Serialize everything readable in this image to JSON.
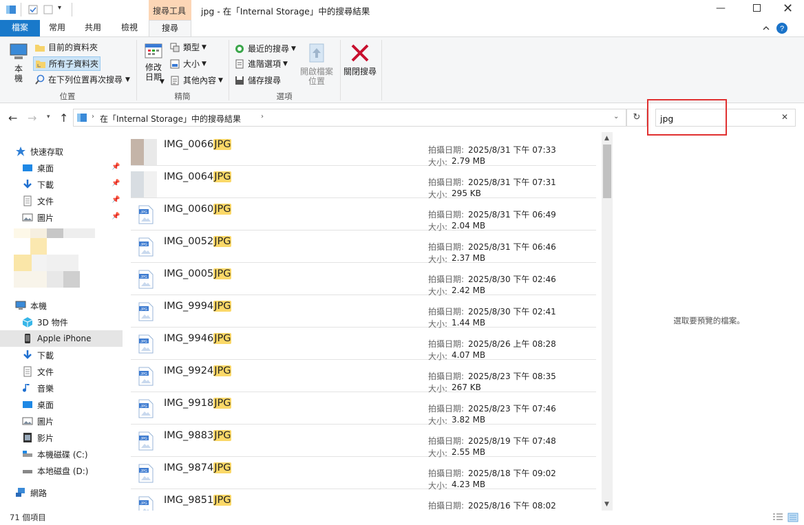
{
  "window": {
    "title": "jpg - 在「Internal Storage」中的搜尋結果",
    "context_tab": "搜尋工具"
  },
  "tabs": [
    {
      "label": "檔案"
    },
    {
      "label": "常用"
    },
    {
      "label": "共用"
    },
    {
      "label": "檢視"
    },
    {
      "label": "搜尋"
    }
  ],
  "ribbon": {
    "location": {
      "this_pc": "本\n機",
      "current_folder": "目前的資料夾",
      "all_subfolders": "所有子資料夾",
      "search_again": "在下列位置再次搜尋",
      "group": "位置"
    },
    "refine": {
      "modified_date": "修改\n日期",
      "kind": "類型",
      "size": "大小",
      "other": "其他內容",
      "group": "精簡"
    },
    "options": {
      "recent": "最近的搜尋",
      "advanced": "進階選項",
      "save": "儲存搜尋",
      "open_location": "開啟檔案\n位置",
      "group": "選項"
    },
    "close_search": "關閉搜尋"
  },
  "address": {
    "path": "在「Internal Storage」中的搜尋結果",
    "search_value": "jpg"
  },
  "nav": {
    "quick_access": "快速存取",
    "quick": [
      {
        "label": "桌面",
        "icon": "desktop-icon"
      },
      {
        "label": "下載",
        "icon": "download-icon"
      },
      {
        "label": "文件",
        "icon": "documents-icon"
      },
      {
        "label": "圖片",
        "icon": "pictures-icon"
      }
    ],
    "this_pc": "本機",
    "pc": [
      {
        "label": "3D 物件",
        "icon": "3d-objects-icon"
      },
      {
        "label": "Apple iPhone",
        "icon": "phone-icon"
      },
      {
        "label": "下載",
        "icon": "download-icon"
      },
      {
        "label": "文件",
        "icon": "documents-icon"
      },
      {
        "label": "音樂",
        "icon": "music-icon"
      },
      {
        "label": "桌面",
        "icon": "desktop-icon"
      },
      {
        "label": "圖片",
        "icon": "pictures-icon"
      },
      {
        "label": "影片",
        "icon": "videos-icon"
      },
      {
        "label": "本機磁碟 (C:)",
        "icon": "drive-icon"
      },
      {
        "label": "本地磁盘 (D:)",
        "icon": "drive-icon"
      }
    ],
    "network": "網路"
  },
  "labels": {
    "date": "拍攝日期:",
    "size": "大小:",
    "highlight": "JPG"
  },
  "files": [
    {
      "name": "IMG_0066",
      "date": "2025/8/31 下午 07:33",
      "size": "2.79 MB"
    },
    {
      "name": "IMG_0064",
      "date": "2025/8/31 下午 07:31",
      "size": "295 KB"
    },
    {
      "name": "IMG_0060",
      "date": "2025/8/31 下午 06:49",
      "size": "2.04 MB"
    },
    {
      "name": "IMG_0052",
      "date": "2025/8/31 下午 06:46",
      "size": "2.37 MB"
    },
    {
      "name": "IMG_0005",
      "date": "2025/8/30 下午 02:46",
      "size": "2.42 MB"
    },
    {
      "name": "IMG_9994",
      "date": "2025/8/30 下午 02:41",
      "size": "1.44 MB"
    },
    {
      "name": "IMG_9946",
      "date": "2025/8/26 上午 08:28",
      "size": "4.07 MB"
    },
    {
      "name": "IMG_9924",
      "date": "2025/8/23 下午 08:35",
      "size": "267 KB"
    },
    {
      "name": "IMG_9918",
      "date": "2025/8/23 下午 07:46",
      "size": "3.82 MB"
    },
    {
      "name": "IMG_9883",
      "date": "2025/8/19 下午 07:48",
      "size": "2.55 MB"
    },
    {
      "name": "IMG_9874",
      "date": "2025/8/18 下午 09:02",
      "size": "4.23 MB"
    },
    {
      "name": "IMG_9851",
      "date": "2025/8/16 下午 08:02",
      "size": ""
    }
  ],
  "preview": {
    "empty": "選取要預覽的檔案。"
  },
  "status": {
    "count": "71 個項目"
  },
  "colors": {
    "accent": "#1979ca",
    "context_tab": "#fcd6b6",
    "highlight": "#fbd868",
    "annotation": "#e03030"
  }
}
